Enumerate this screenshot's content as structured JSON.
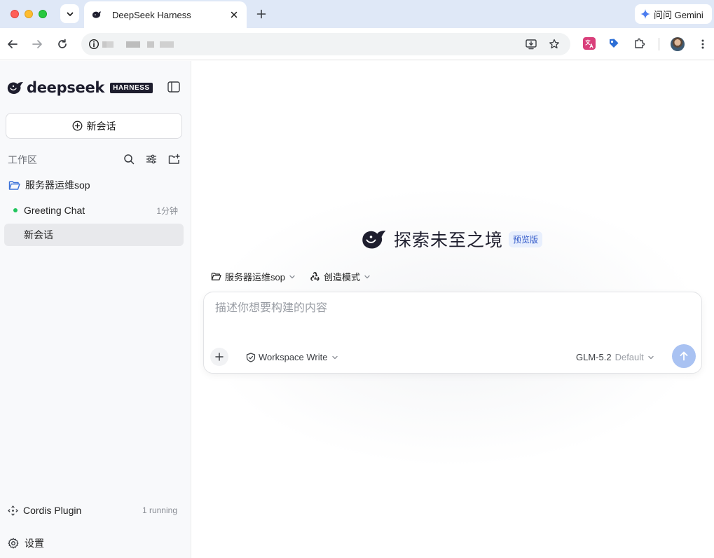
{
  "browser": {
    "tab_title": "DeepSeek Harness",
    "gemini_label": "问问 Gemini"
  },
  "sidebar": {
    "brand": "deepseek",
    "brand_badge": "HARNESS",
    "new_chat_label": "新会话",
    "workspace_label": "工作区",
    "folder_label": "服务器运维sop",
    "chats": [
      {
        "title": "Greeting Chat",
        "time": "1分钟",
        "status_color": "#22c55e"
      },
      {
        "title": "新会话",
        "time": ""
      }
    ],
    "plugin": {
      "label": "Cordis Plugin",
      "status": "1 running"
    },
    "settings_label": "设置"
  },
  "main": {
    "hero_title": "探索未至之境",
    "preview_badge": "预览版",
    "folder_selector": "服务器运维sop",
    "mode_selector": "创造模式",
    "composer": {
      "placeholder": "描述你想要构建的内容",
      "permission": "Workspace Write",
      "model": "GLM-5.2",
      "model_tag": "Default"
    }
  },
  "colors": {
    "accent": "#2f57c8",
    "send_button": "#a9c2f2",
    "status_running": "#22c55e"
  }
}
